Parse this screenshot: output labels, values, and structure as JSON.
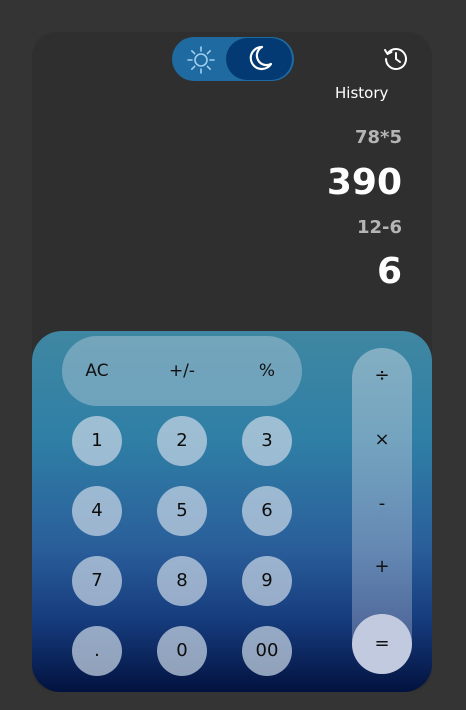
{
  "theme": {
    "light_icon": "sun-icon",
    "dark_icon": "moon-icon",
    "active": "dark"
  },
  "history": {
    "icon": "history-icon",
    "label": "History"
  },
  "display": {
    "entries": [
      {
        "expression": "78*5",
        "result": "390"
      },
      {
        "expression": "12-6",
        "result": "6"
      }
    ]
  },
  "keys": {
    "top": [
      "AC",
      "+/-",
      "%"
    ],
    "digits": [
      "1",
      "2",
      "3",
      "4",
      "5",
      "6",
      "7",
      "8",
      "9",
      ".",
      "0",
      "00"
    ],
    "ops": [
      "÷",
      "×",
      "-",
      "+"
    ],
    "equals": "="
  }
}
